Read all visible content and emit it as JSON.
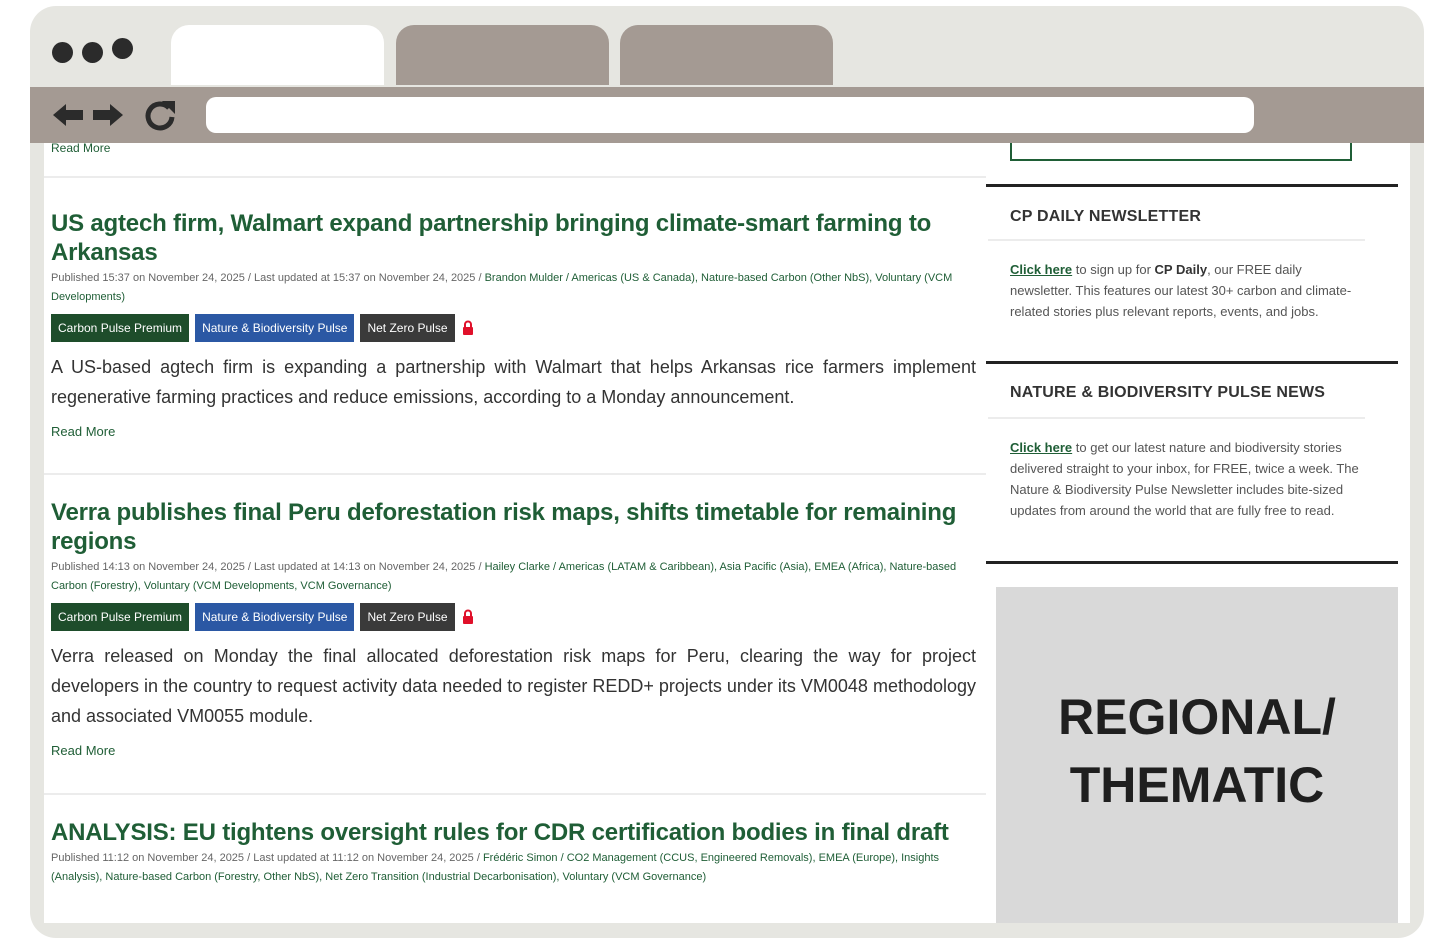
{
  "browser": {
    "tabs": [
      "",
      "",
      ""
    ],
    "url": ""
  },
  "top_read_more": "Read More",
  "articles": [
    {
      "title": "US agtech firm, Walmart expand partnership bringing climate-smart farming to Arkansas",
      "meta_prefix": "Published 15:37 on November 24, 2025 / Last updated at 15:37 on November 24, 2025 / ",
      "meta_links": "Brandon Mulder / Americas (US & Canada), Nature-based Carbon (Other NbS), Voluntary (VCM Developments)",
      "tags": [
        "Carbon Pulse Premium",
        "Nature & Biodiversity Pulse",
        "Net Zero Pulse"
      ],
      "body": "A US-based agtech firm is expanding a partnership with Walmart that helps Arkansas rice farmers implement regenerative farming practices and reduce emissions, according to a Monday announcement.",
      "read_more": "Read More"
    },
    {
      "title": "Verra publishes final Peru deforestation risk maps, shifts timetable for remaining regions",
      "meta_prefix": "Published 14:13 on November 24, 2025 / Last updated at 14:13 on November 24, 2025 / ",
      "meta_links": "Hailey Clarke / Americas (LATAM & Caribbean), Asia Pacific (Asia), EMEA (Africa), Nature-based Carbon (Forestry), Voluntary (VCM Developments, VCM Governance)",
      "tags": [
        "Carbon Pulse Premium",
        "Nature & Biodiversity Pulse",
        "Net Zero Pulse"
      ],
      "body": "Verra released on Monday the final allocated deforestation risk maps for Peru, clearing the way for project developers in the country to request activity data needed to register REDD+ projects under its VM0048 methodology and associated VM0055 module.",
      "read_more": "Read More"
    },
    {
      "title": "ANALYSIS: EU tightens oversight rules for CDR certification bodies in final draft",
      "meta_prefix": "Published 11:12 on November 24, 2025 / Last updated at 11:12 on November 24, 2025 / ",
      "meta_links": "Frédéric Simon / CO2 Management (CCUS, Engineered Removals), EMEA (Europe), Insights (Analysis), Nature-based Carbon (Forestry, Other NbS), Net Zero Transition (Industrial Decarbonisation), Voluntary (VCM Governance)"
    }
  ],
  "sidebar": {
    "newsletter": {
      "heading": "CP DAILY NEWSLETTER",
      "link": "Click here",
      "text_a": " to sign up for ",
      "bold": "CP Daily",
      "text_b": ", our FREE daily newsletter. This features our latest 30+ carbon and climate-related stories plus relevant reports, events, and jobs."
    },
    "nature": {
      "heading": "NATURE & BIODIVERSITY PULSE NEWS",
      "link": "Click here",
      "text": " to get our latest nature and biodiversity stories delivered straight to your inbox, for FREE, twice a week. The Nature & Biodiversity Pulse Newsletter includes bite-sized updates from around the world that are fully free to read."
    },
    "promo": {
      "line1": "REGIONAL/",
      "line2": "THEMATIC"
    }
  },
  "colors": {
    "frame": "#e6e6e1",
    "toolbar": "#a49a93",
    "headline_green": "#1f5e36",
    "tag_green": "#1e4d2b",
    "tag_blue": "#2b58a4",
    "tag_dark": "#3a3a3a",
    "lock_red": "#e0102a"
  }
}
